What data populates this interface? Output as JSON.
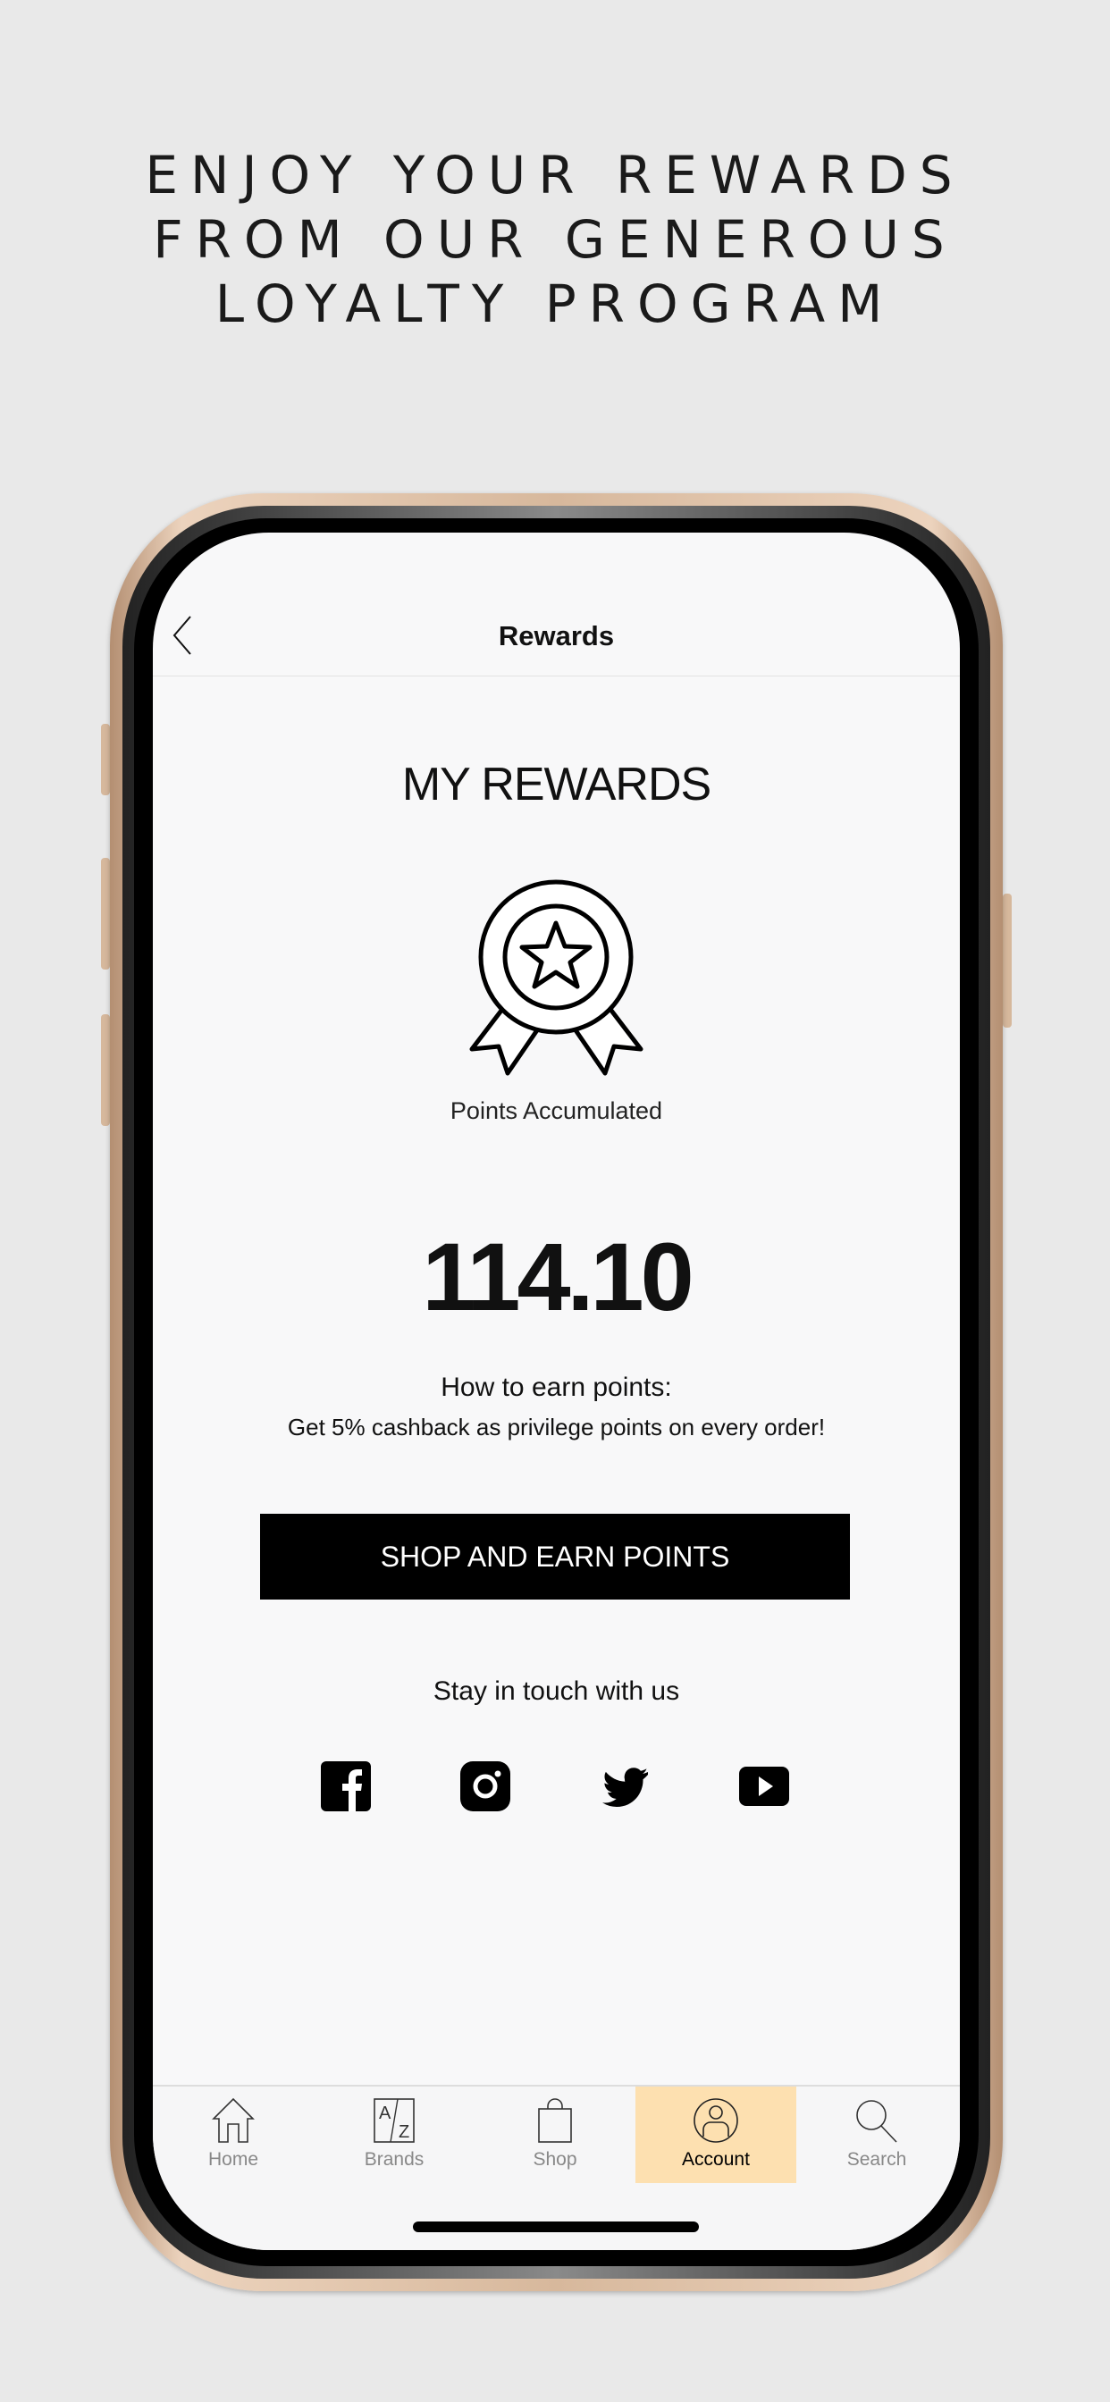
{
  "headline": [
    "ENJOY YOUR REWARDS",
    "FROM OUR GENEROUS",
    "LOYALTY PROGRAM"
  ],
  "nav": {
    "title": "Rewards",
    "back_icon": "chevron-left-icon"
  },
  "rewards": {
    "heading": "MY REWARDS",
    "badge_icon": "award-ribbon-star-icon",
    "points_label": "Points Accumulated",
    "points_value": "114.10",
    "how_title": "How to earn points:",
    "how_desc": "Get 5% cashback as privilege points on every order!",
    "cta_label": "SHOP AND EARN POINTS"
  },
  "social": {
    "title": "Stay in touch with us",
    "icons": [
      "facebook-icon",
      "instagram-icon",
      "twitter-icon",
      "youtube-icon"
    ]
  },
  "tabbar": {
    "items": [
      {
        "label": "Home",
        "icon": "home-icon"
      },
      {
        "label": "Brands",
        "icon": "a-z-icon"
      },
      {
        "label": "Shop",
        "icon": "shopping-bag-icon"
      },
      {
        "label": "Account",
        "icon": "account-icon",
        "active": true
      },
      {
        "label": "Search",
        "icon": "search-icon"
      }
    ]
  },
  "colors": {
    "active_tab": "#fde0b0",
    "cta": "#000000",
    "background": "#e9e9e9",
    "phone_frame": "#d7b89c"
  }
}
